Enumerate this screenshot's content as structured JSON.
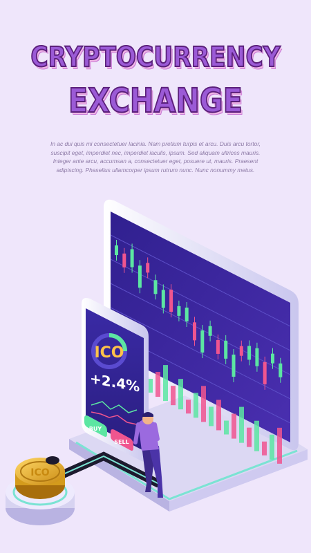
{
  "header": {
    "title_line1": "CRYPTOCURRENCY",
    "title_line2": "EXCHANGE"
  },
  "description": "In ac dui quis mi consectetuer lacinia. Nam pretium turpis et arcu. Duis arcu tortor, suscipit eget, imperdiet nec, imperdiet iaculis, ipsum. Sed aliquam ultrices mauris. Integer ante arcu, accumsan a, consectetuer eget, posuere ut, mauris. Praesent adipiscing. Phasellus ullamcorper ipsum rutrum nunc. Nunc nonummy metus.",
  "phone": {
    "badge": "ICO",
    "change": "+2.4%",
    "buy_label": "BUY",
    "sell_label": "SELL"
  },
  "coin": {
    "label": "ICO"
  },
  "colors": {
    "background": "#efe6fb",
    "title_fill": "#9b5ad6",
    "screen": "#2a1f8f",
    "up": "#5ce6a2",
    "down": "#f0558f",
    "coin": "#d8a520"
  }
}
